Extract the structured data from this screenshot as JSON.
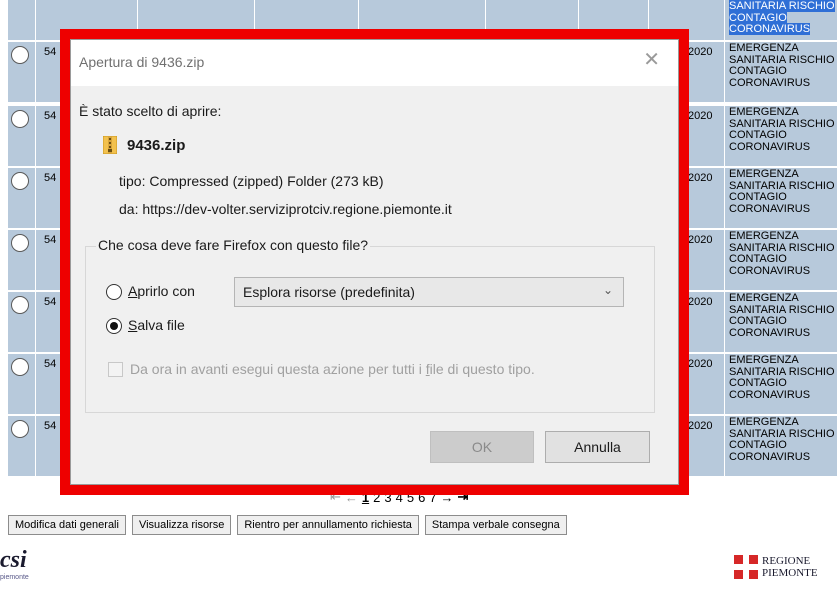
{
  "table": {
    "top_desc": [
      "SANITARIA RISCHIO",
      "CONTAGIO",
      "CORONAVIRUS"
    ],
    "rows": [
      {
        "id": "54",
        "year": "2020",
        "desc": [
          "EMERGENZA",
          "SANITARIA RISCHIO",
          "CONTAGIO",
          "CORONAVIRUS"
        ]
      },
      {
        "id": "54",
        "year": "2020",
        "desc": [
          "EMERGENZA",
          "SANITARIA RISCHIO",
          "CONTAGIO",
          "CORONAVIRUS"
        ]
      },
      {
        "id": "54",
        "year": "2020",
        "desc": [
          "EMERGENZA",
          "SANITARIA RISCHIO",
          "CONTAGIO",
          "CORONAVIRUS"
        ]
      },
      {
        "id": "54",
        "year": "2020",
        "desc": [
          "EMERGENZA",
          "SANITARIA RISCHIO",
          "CONTAGIO",
          "CORONAVIRUS"
        ]
      },
      {
        "id": "54",
        "year": "2020",
        "desc": [
          "EMERGENZA",
          "SANITARIA RISCHIO",
          "CONTAGIO",
          "CORONAVIRUS"
        ]
      },
      {
        "id": "54",
        "year": "2020",
        "desc": [
          "EMERGENZA",
          "SANITARIA RISCHIO",
          "CONTAGIO",
          "CORONAVIRUS"
        ]
      },
      {
        "id": "54",
        "year": "2020",
        "desc": [
          "EMERGENZA",
          "SANITARIA RISCHIO",
          "CONTAGIO",
          "CORONAVIRUS"
        ]
      }
    ]
  },
  "pager": {
    "first_icon": "first-page-icon",
    "prev_icon": "prev-page-icon",
    "current": "1",
    "pages": [
      "2",
      "3",
      "4",
      "5",
      "6",
      "7"
    ],
    "next_icon": "next-page-icon",
    "last_icon": "last-page-icon",
    "first_glyph": "⇤",
    "prev_glyph": "←",
    "next_glyph": "→",
    "last_glyph": "⇥"
  },
  "buttons": {
    "modifica": "Modifica dati generali",
    "visualizza": "Visualizza risorse",
    "rientro": "Rientro per annullamento richiesta",
    "stampa": "Stampa verbale consegna"
  },
  "logos": {
    "csi": "csi",
    "csi_sub": "piemonte",
    "regione_line1": "REGIONE",
    "regione_line2": "PIEMONTE"
  },
  "dialog": {
    "title": "Apertura di 9436.zip",
    "close_glyph": "✕",
    "intro": "È stato scelto di aprire:",
    "filename": "9436.zip",
    "type_line": "tipo: Compressed (zipped) Folder (273 kB)",
    "from_line": "da: https://dev-volter.serviziprotciv.regione.piemonte.it",
    "question": "Che cosa deve fare Firefox con questo file?",
    "open_with_a": "A",
    "open_with_rest": "prirlo con",
    "open_with_app": "Esplora risorse (predefinita)",
    "save_s": "S",
    "save_rest": "alva file",
    "remember_pre": "Da ora in avanti esegui questa azione per tutti i ",
    "remember_f": "f",
    "remember_post": "ile di questo tipo.",
    "selected_option": "save",
    "ok": "OK",
    "cancel": "Annulla"
  },
  "colors": {
    "highlight_frame": "#ee0000",
    "table_row": "#b7c9db",
    "selection": "#2f6fd6"
  }
}
